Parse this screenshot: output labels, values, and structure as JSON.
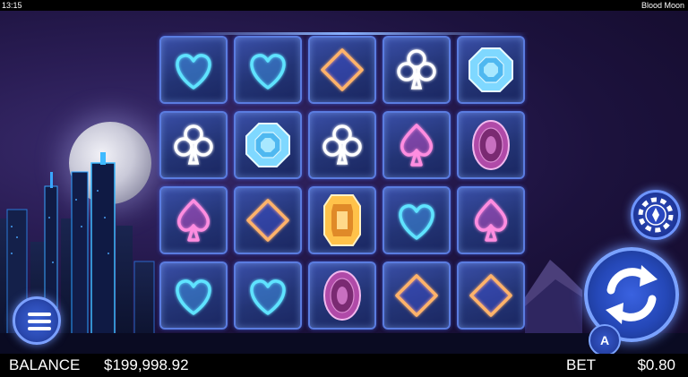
{
  "status_bar": {
    "time": "13:15",
    "game_title": "Blood Moon"
  },
  "reels": [
    [
      "heart-icon",
      "club-icon",
      "spade-icon",
      "heart-icon"
    ],
    [
      "heart-icon",
      "blue-gem-icon",
      "diamond-icon",
      "heart-icon"
    ],
    [
      "diamond-icon",
      "club-icon",
      "gold-gem-icon",
      "purple-gem-icon"
    ],
    [
      "club-icon",
      "spade-icon",
      "heart-icon",
      "diamond-icon"
    ],
    [
      "blue-gem-icon",
      "purple-gem-icon",
      "spade-icon",
      "diamond-icon"
    ]
  ],
  "controls": {
    "autoplay_label": "A"
  },
  "footer": {
    "balance_label": "BALANCE",
    "balance_value": "$199,998.92",
    "bet_label": "BET",
    "bet_value": "$0.80"
  },
  "colors": {
    "heart": "#5fe3ff",
    "club": "#ffffff",
    "spade": "#ff8de0",
    "diamond": "#ffb36a",
    "blue_gem": "#7fd8ff",
    "gold_gem": "#ffc24a",
    "purple_gem": "#b04aa8"
  }
}
